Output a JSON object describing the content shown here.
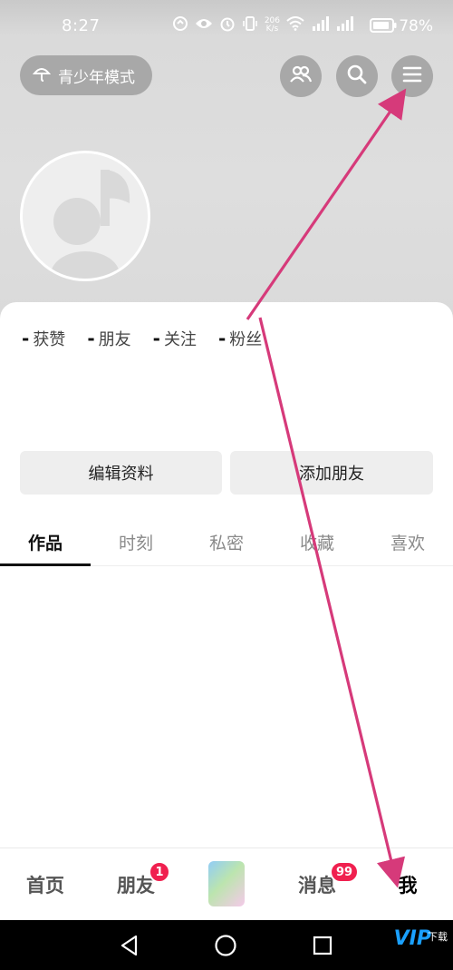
{
  "status_bar": {
    "time": "8:27",
    "net_speed_value": "206",
    "net_speed_unit": "K/s",
    "battery_percent": "78%"
  },
  "header": {
    "teen_mode_label": "青少年模式",
    "icons": [
      "friends-icon",
      "search-icon",
      "menu-icon"
    ]
  },
  "stats": [
    {
      "value": "-",
      "label": "获赞"
    },
    {
      "value": "-",
      "label": "朋友"
    },
    {
      "value": "-",
      "label": "关注"
    },
    {
      "value": "-",
      "label": "粉丝"
    }
  ],
  "actions": {
    "edit_profile": "编辑资料",
    "add_friends": "添加朋友"
  },
  "tabs": [
    "作品",
    "时刻",
    "私密",
    "收藏",
    "喜欢"
  ],
  "active_tab": "作品",
  "bottom_nav": {
    "home": "首页",
    "friends": "朋友",
    "friends_badge": "1",
    "messages": "消息",
    "messages_badge": "99",
    "me": "我"
  },
  "watermark": {
    "logo": "VIP",
    "text": "下载"
  },
  "colors": {
    "badge": "#f0204f",
    "annotation_arrow": "#d63a7a"
  }
}
